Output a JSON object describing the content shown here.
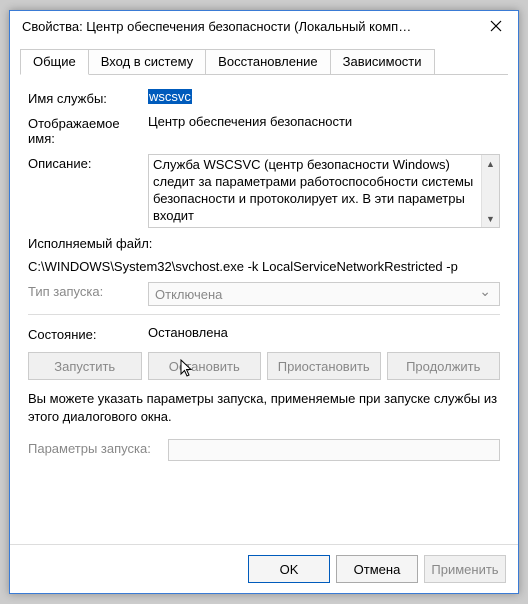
{
  "window": {
    "title": "Свойства: Центр обеспечения безопасности (Локальный комп…"
  },
  "tabs": {
    "general": "Общие",
    "logon": "Вход в систему",
    "recovery": "Восстановление",
    "deps": "Зависимости"
  },
  "labels": {
    "service_name": "Имя службы:",
    "display_name": "Отображаемое имя:",
    "description": "Описание:",
    "path_label": "Исполняемый файл:",
    "startup_type": "Тип запуска:",
    "status": "Состояние:",
    "params": "Параметры запуска:"
  },
  "values": {
    "service_name": "wscsvc",
    "display_name": "Центр обеспечения безопасности",
    "description": "Служба WSCSVC (центр безопасности Windows) следит за параметрами работоспособности системы безопасности и протоколирует их. В эти параметры входит",
    "path": "C:\\WINDOWS\\System32\\svchost.exe -k LocalServiceNetworkRestricted -p",
    "startup_type": "Отключена",
    "status": "Остановлена",
    "params": ""
  },
  "buttons": {
    "start": "Запустить",
    "stop": "Остановить",
    "pause": "Приостановить",
    "resume": "Продолжить"
  },
  "info": "Вы можете указать параметры запуска, применяемые при запуске службы из этого диалогового окна.",
  "footer": {
    "ok": "OK",
    "cancel": "Отмена",
    "apply": "Применить"
  }
}
